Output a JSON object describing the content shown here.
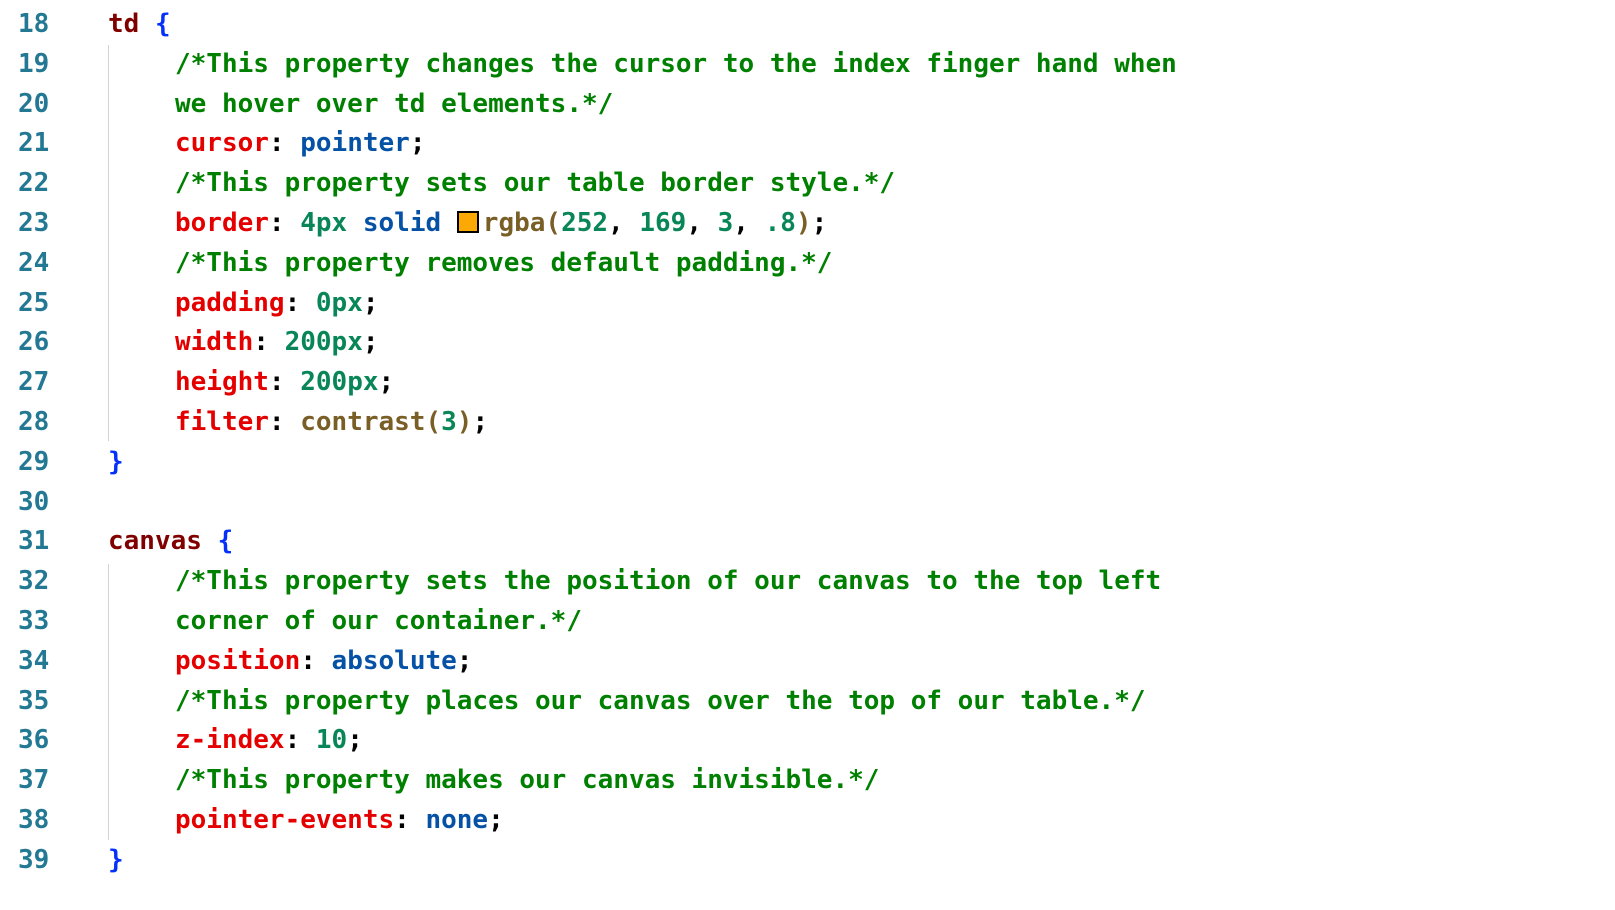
{
  "lines": [
    {
      "n": "18",
      "tokens": [
        [
          "sel",
          "td"
        ],
        [
          "punc",
          " "
        ],
        [
          "brace",
          "{"
        ]
      ]
    },
    {
      "n": "19",
      "indent": 1,
      "tokens": [
        [
          "comment",
          "/*This property changes the cursor to the index finger hand when"
        ]
      ]
    },
    {
      "n": "20",
      "indent": 1,
      "tokens": [
        [
          "comment",
          "we hover over td elements.*/"
        ]
      ]
    },
    {
      "n": "21",
      "indent": 1,
      "tokens": [
        [
          "prop",
          "cursor"
        ],
        [
          "punc",
          ": "
        ],
        [
          "kw",
          "pointer"
        ],
        [
          "punc",
          ";"
        ]
      ]
    },
    {
      "n": "22",
      "indent": 1,
      "tokens": [
        [
          "comment",
          "/*This property sets our table border style.*/"
        ]
      ]
    },
    {
      "n": "23",
      "indent": 1,
      "tokens": [
        [
          "prop",
          "border"
        ],
        [
          "punc",
          ": "
        ],
        [
          "num",
          "4px"
        ],
        [
          "punc",
          " "
        ],
        [
          "kw",
          "solid"
        ],
        [
          "punc",
          " "
        ],
        [
          "swatch",
          ""
        ],
        [
          "fn",
          "rgba("
        ],
        [
          "num",
          "252"
        ],
        [
          "punc",
          ", "
        ],
        [
          "num",
          "169"
        ],
        [
          "punc",
          ", "
        ],
        [
          "num",
          "3"
        ],
        [
          "punc",
          ", "
        ],
        [
          "num",
          ".8"
        ],
        [
          "fn",
          ")"
        ],
        [
          "punc",
          ";"
        ]
      ]
    },
    {
      "n": "24",
      "indent": 1,
      "tokens": [
        [
          "comment",
          "/*This property removes default padding.*/"
        ]
      ]
    },
    {
      "n": "25",
      "indent": 1,
      "tokens": [
        [
          "prop",
          "padding"
        ],
        [
          "punc",
          ": "
        ],
        [
          "num",
          "0px"
        ],
        [
          "punc",
          ";"
        ]
      ]
    },
    {
      "n": "26",
      "indent": 1,
      "tokens": [
        [
          "prop",
          "width"
        ],
        [
          "punc",
          ": "
        ],
        [
          "num",
          "200px"
        ],
        [
          "punc",
          ";"
        ]
      ]
    },
    {
      "n": "27",
      "indent": 1,
      "tokens": [
        [
          "prop",
          "height"
        ],
        [
          "punc",
          ": "
        ],
        [
          "num",
          "200px"
        ],
        [
          "punc",
          ";"
        ]
      ]
    },
    {
      "n": "28",
      "indent": 1,
      "tokens": [
        [
          "prop",
          "filter"
        ],
        [
          "punc",
          ": "
        ],
        [
          "fn",
          "contrast("
        ],
        [
          "num",
          "3"
        ],
        [
          "fn",
          ")"
        ],
        [
          "punc",
          ";"
        ]
      ]
    },
    {
      "n": "29",
      "tokens": [
        [
          "brace",
          "}"
        ]
      ]
    },
    {
      "n": "30",
      "tokens": []
    },
    {
      "n": "31",
      "tokens": [
        [
          "sel",
          "canvas"
        ],
        [
          "punc",
          " "
        ],
        [
          "brace",
          "{"
        ]
      ]
    },
    {
      "n": "32",
      "indent": 1,
      "tokens": [
        [
          "comment",
          "/*This property sets the position of our canvas to the top left"
        ]
      ]
    },
    {
      "n": "33",
      "indent": 1,
      "tokens": [
        [
          "comment",
          "corner of our container.*/"
        ]
      ]
    },
    {
      "n": "34",
      "indent": 1,
      "tokens": [
        [
          "prop",
          "position"
        ],
        [
          "punc",
          ": "
        ],
        [
          "kw",
          "absolute"
        ],
        [
          "punc",
          ";"
        ]
      ]
    },
    {
      "n": "35",
      "indent": 1,
      "tokens": [
        [
          "comment",
          "/*This property places our canvas over the top of our table.*/"
        ]
      ]
    },
    {
      "n": "36",
      "indent": 1,
      "tokens": [
        [
          "prop",
          "z-index"
        ],
        [
          "punc",
          ": "
        ],
        [
          "num",
          "10"
        ],
        [
          "punc",
          ";"
        ]
      ]
    },
    {
      "n": "37",
      "indent": 1,
      "tokens": [
        [
          "comment",
          "/*This property makes our canvas invisible.*/"
        ]
      ]
    },
    {
      "n": "38",
      "indent": 1,
      "tokens": [
        [
          "prop",
          "pointer-events"
        ],
        [
          "punc",
          ": "
        ],
        [
          "kw",
          "none"
        ],
        [
          "punc",
          ";"
        ]
      ]
    },
    {
      "n": "39",
      "tokens": [
        [
          "brace",
          "}"
        ]
      ]
    }
  ],
  "colors": {
    "swatch_fill": "#fca903",
    "selector": "#800000",
    "brace": "#0431fa",
    "comment": "#008000",
    "property": "#e50000",
    "keyword": "#0451a5",
    "number": "#098658",
    "function": "#795e26",
    "line_number": "#237893"
  }
}
